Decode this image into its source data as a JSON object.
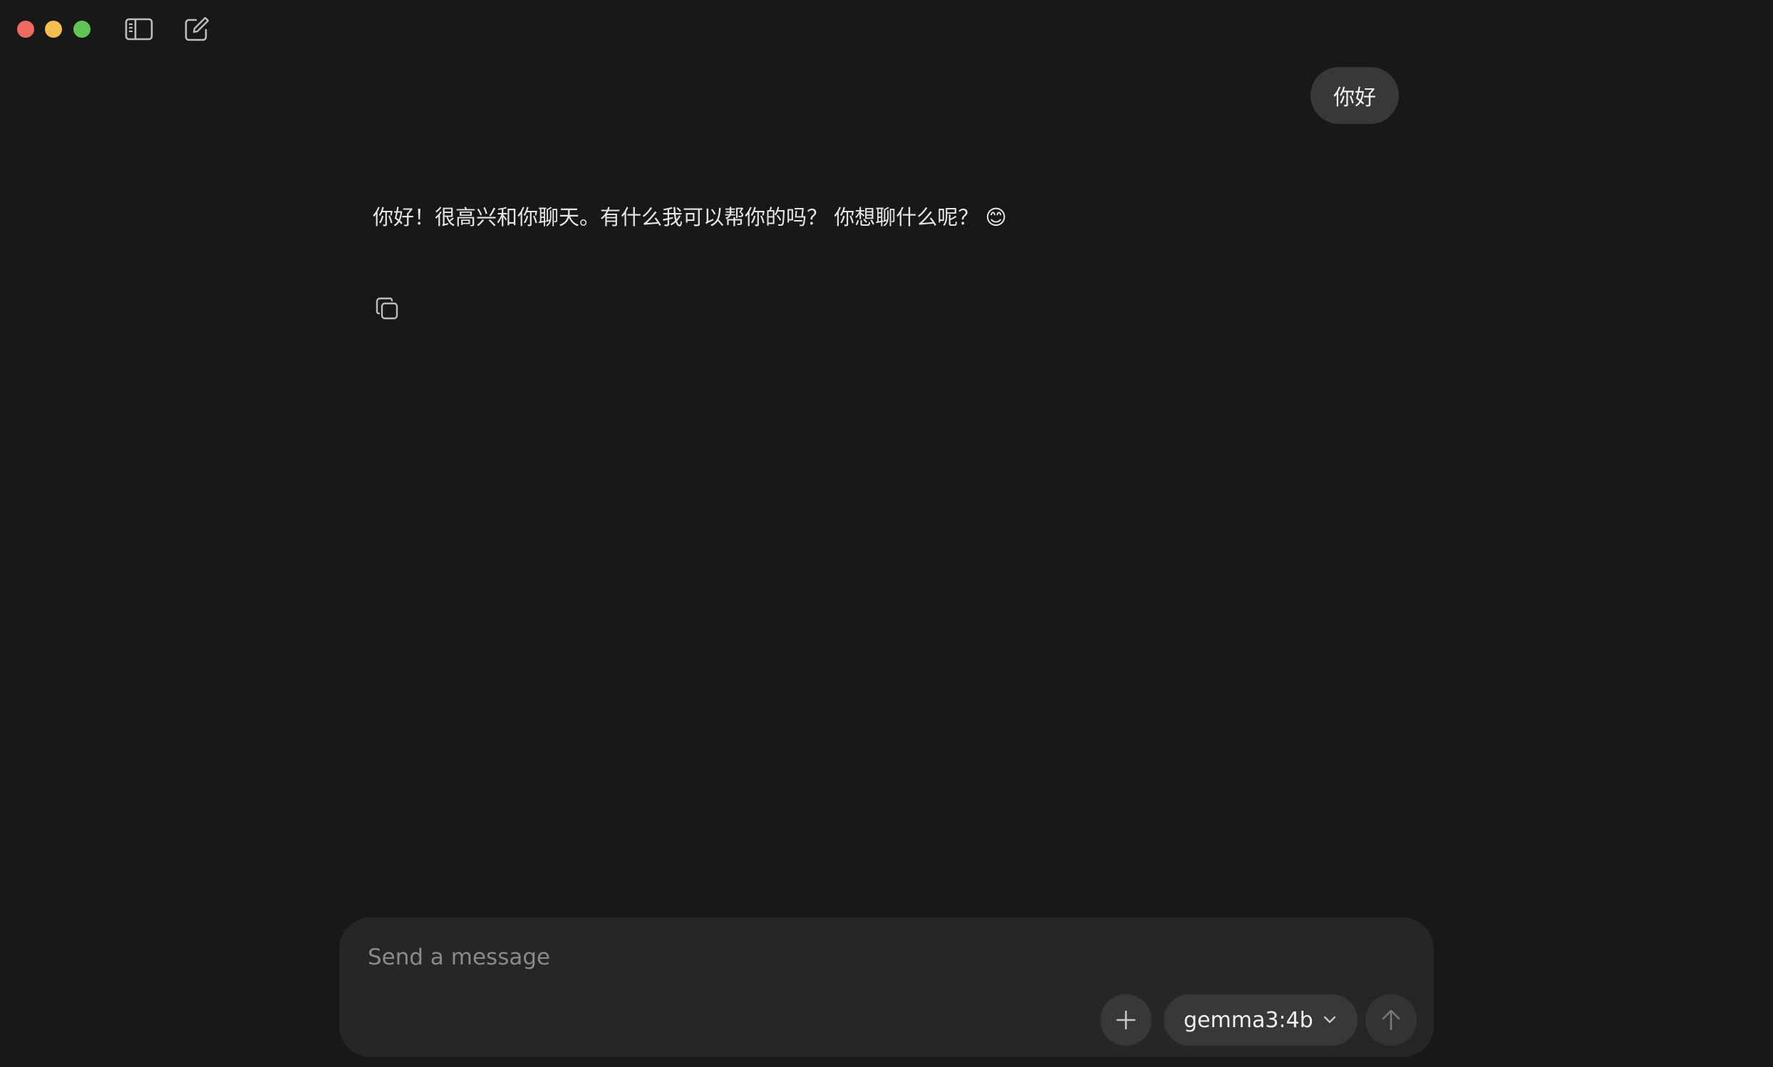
{
  "window": {
    "controls": [
      "close",
      "minimize",
      "maximize"
    ]
  },
  "toolbar": {
    "sidebar_icon": "sidebar-toggle-icon",
    "compose_icon": "new-chat-icon"
  },
  "conversation": {
    "user_message": "你好",
    "assistant_message": "你好！很高兴和你聊天。有什么我可以帮你的吗？ 你想聊什么呢？ 😊",
    "copy_icon": "copy-icon"
  },
  "composer": {
    "placeholder": "Send a message",
    "value": "",
    "model": "gemma3:4b"
  },
  "colors": {
    "background": "#181818",
    "bubble": "#383838",
    "composer": "#262626",
    "close": "#ec6a5f",
    "minimize": "#f4bf4f",
    "maximize": "#61c554"
  }
}
